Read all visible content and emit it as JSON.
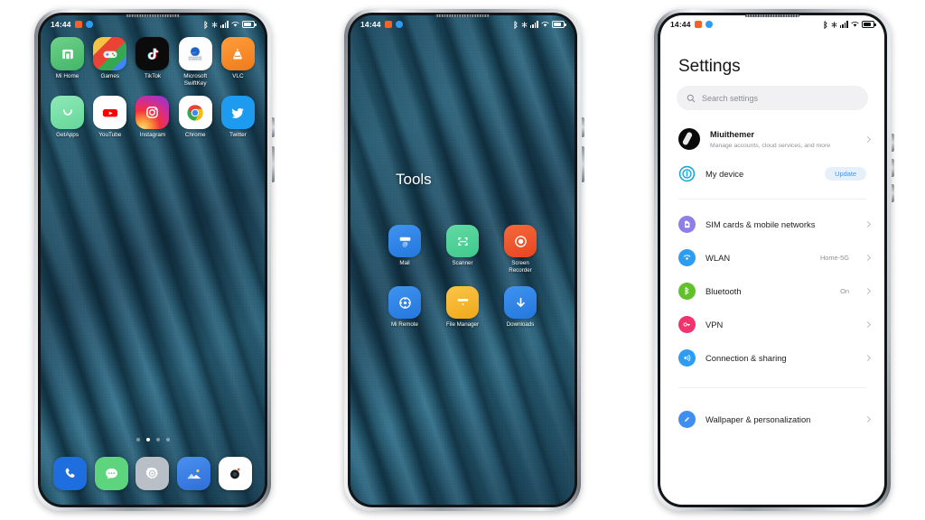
{
  "status_bar": {
    "time": "14:44",
    "badges": [
      "notification-badge-orange",
      "notification-badge-blue"
    ],
    "icons": [
      "bluetooth-icon",
      "alarm-icon",
      "signal-icon",
      "wifi-icon",
      "battery-icon"
    ]
  },
  "phone_home": {
    "name": "home-screen",
    "rows": [
      [
        {
          "label": "Mi Home",
          "icon": "mi-home-icon"
        },
        {
          "label": "Games",
          "icon": "games-icon"
        },
        {
          "label": "TikTok",
          "icon": "tiktok-icon"
        },
        {
          "label": "Microsoft SwiftKey",
          "icon": "swiftkey-icon"
        },
        {
          "label": "VLC",
          "icon": "vlc-icon"
        }
      ],
      [
        {
          "label": "GetApps",
          "icon": "getapps-icon"
        },
        {
          "label": "YouTube",
          "icon": "youtube-icon"
        },
        {
          "label": "Instagram",
          "icon": "instagram-icon"
        },
        {
          "label": "Chrome",
          "icon": "chrome-icon"
        },
        {
          "label": "Twitter",
          "icon": "twitter-icon"
        }
      ]
    ],
    "page_dots": {
      "count": 4,
      "active": 1
    },
    "dock": [
      {
        "label": "Phone",
        "icon": "phone-icon"
      },
      {
        "label": "Messages",
        "icon": "messages-icon"
      },
      {
        "label": "Settings",
        "icon": "settings-gear-icon"
      },
      {
        "label": "Gallery",
        "icon": "gallery-icon"
      },
      {
        "label": "Camera",
        "icon": "camera-icon"
      }
    ]
  },
  "phone_folder": {
    "name": "folder-screen",
    "title": "Tools",
    "apps": [
      {
        "label": "Mail",
        "icon": "mail-icon"
      },
      {
        "label": "Scanner",
        "icon": "scanner-icon"
      },
      {
        "label": "Screen Recorder",
        "icon": "screen-recorder-icon"
      },
      {
        "label": "Mi Remote",
        "icon": "mi-remote-icon"
      },
      {
        "label": "File Manager",
        "icon": "file-manager-icon"
      },
      {
        "label": "Downloads",
        "icon": "downloads-icon"
      }
    ]
  },
  "phone_settings": {
    "name": "settings-screen",
    "title": "Settings",
    "search": {
      "placeholder": "Search settings",
      "icon": "search-icon"
    },
    "account": {
      "name": "Miuithemer",
      "subtitle": "Manage accounts, cloud services, and more",
      "avatar": "account-avatar"
    },
    "my_device": {
      "label": "My device",
      "badge": "Update",
      "icon": "device-info-icon"
    },
    "groups": [
      {
        "items": [
          {
            "label": "SIM cards & mobile networks",
            "value": "",
            "icon": "sim-card-icon",
            "color": "#8f7de8"
          },
          {
            "label": "WLAN",
            "value": "Home-5G",
            "icon": "wifi-settings-icon",
            "color": "#2e9cf0"
          },
          {
            "label": "Bluetooth",
            "value": "On",
            "icon": "bluetooth-settings-icon",
            "color": "#62c12b"
          },
          {
            "label": "VPN",
            "value": "",
            "icon": "vpn-key-icon",
            "color": "#f1336e"
          },
          {
            "label": "Connection & sharing",
            "value": "",
            "icon": "connection-sharing-icon",
            "color": "#2e9cf0"
          }
        ]
      },
      {
        "items": [
          {
            "label": "Wallpaper & personalization",
            "value": "",
            "icon": "wallpaper-personalization-icon",
            "color": "#3f8ef0"
          }
        ]
      }
    ]
  },
  "theme": {
    "accent": "#2e9cf0",
    "update_pill_bg": "#e6f0fb",
    "update_pill_text": "#4a92e0",
    "page_bg": "#ffffff",
    "wallpaper_base": "#1d4f68"
  }
}
